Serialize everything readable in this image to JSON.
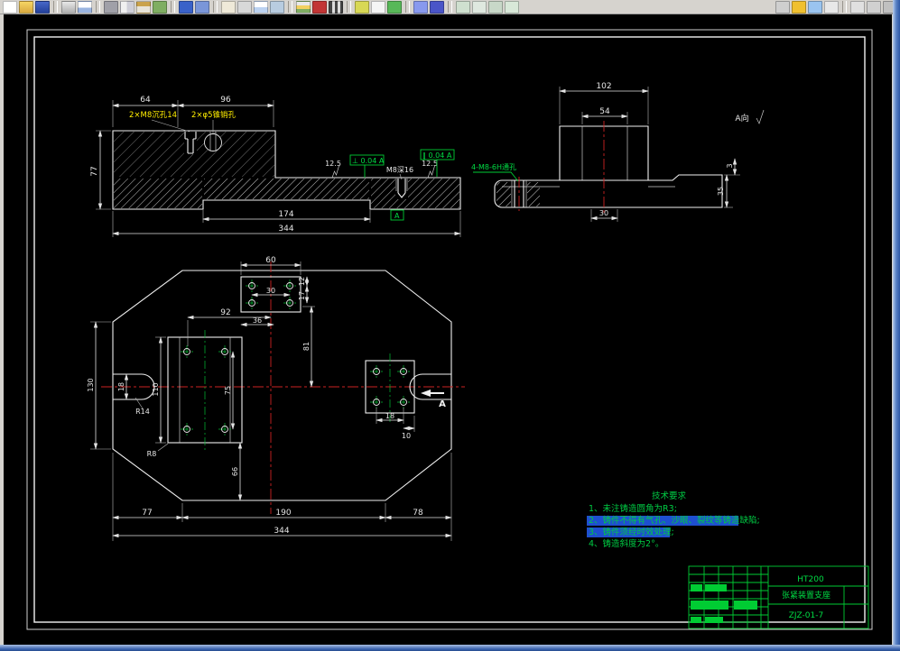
{
  "toolbar": {
    "icons": [
      "new",
      "open",
      "save",
      "print",
      "print-preview",
      "cut",
      "copy",
      "paste",
      "match-properties",
      "undo",
      "redo",
      "pan",
      "zoom-realtime",
      "zoom-window",
      "zoom-previous",
      "layers",
      "color-control",
      "linetype",
      "measure-distance",
      "text-style",
      "dimension-style",
      "properties",
      "help",
      "osnap",
      "ortho",
      "grid",
      "polar",
      "render",
      "toolbox",
      "calculator",
      "spell-check",
      "dock-toggle",
      "panel-toggle",
      "overflow"
    ]
  },
  "drawing": {
    "front": {
      "d64": "64",
      "d96": "96",
      "d77": "77",
      "d174": "174",
      "d344": "344",
      "note1": "2×M8沉孔14",
      "note2": "2×φ5锥销孔",
      "thread": "M8深16",
      "r1": "12.5",
      "r2": "12.5",
      "fcf1": "⊥ 0.04 A",
      "fcf2": "∥ 0.04 A",
      "datum": "A"
    },
    "side": {
      "d102": "102",
      "d54": "54",
      "d3": "3",
      "d35": "35",
      "d30": "30",
      "holes": "4-M8-6H通孔",
      "aview": "A向"
    },
    "plan": {
      "d60": "60",
      "d30": "30",
      "d12": "12",
      "d17": "17",
      "d92": "92",
      "d36": "36",
      "d81": "81",
      "d75": "75",
      "d110": "110",
      "d130": "130",
      "d18slot": "18",
      "d18r": "18",
      "d10": "10",
      "d66": "66",
      "d77": "77",
      "d190": "190",
      "d78": "78",
      "d344": "344",
      "r14": "R14",
      "r8": "R8",
      "section": "A"
    },
    "tech": {
      "title": "技术要求",
      "i1": "1、未注铸造圆角为R3;",
      "i2": "2、铸件不得有气孔、沙眼、裂纹等铸造缺陷;",
      "i3": "3、铸件须经时效处理;",
      "i4": "4、铸造斜度为2°。"
    },
    "title_block": {
      "material": "HT200",
      "part_name": "张紧装置支座",
      "drawing_no": "ZJZ-01-7"
    }
  }
}
